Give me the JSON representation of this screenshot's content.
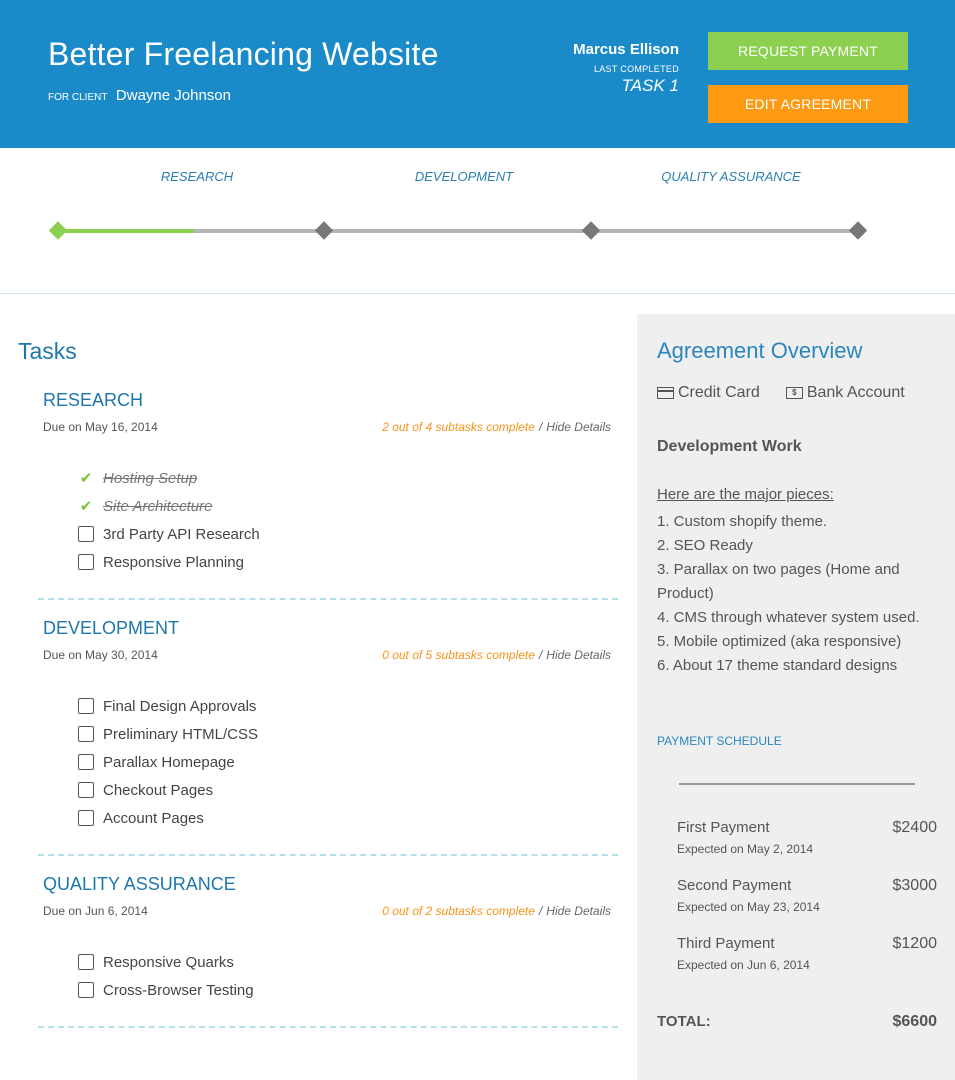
{
  "header": {
    "project_title": "Better Freelancing Website",
    "client_prefix": "For Client",
    "client_name": "Dwayne Johnson",
    "freelancer_name": "Marcus Ellison",
    "last_completed_label": "Last Completed",
    "last_completed_value": "TASK 1",
    "request_payment_label": "Request Payment",
    "edit_agreement_label": "Edit Agreement",
    "colors": {
      "header_bg": "#1a8ac9",
      "request_btn": "#8bd04f",
      "edit_btn": "#fd9a11"
    }
  },
  "progress": {
    "phases": [
      "Research",
      "Development",
      "Quality Assurance"
    ],
    "milestones_completed": 1,
    "fill_fraction": 0.17,
    "colors": {
      "done": "#8bd04f",
      "pending": "#777777"
    }
  },
  "tasks": {
    "title": "Tasks",
    "groups": [
      {
        "title": "Research",
        "due": "Due on May 16, 2014",
        "summary": "2 out of 4 subtasks complete",
        "hide_label": "Hide Details",
        "subtasks": [
          {
            "label": "Hosting Setup",
            "complete": true
          },
          {
            "label": "Site Architecture",
            "complete": true
          },
          {
            "label": "3rd Party API Research",
            "complete": false
          },
          {
            "label": "Responsive Planning",
            "complete": false
          }
        ]
      },
      {
        "title": "Development",
        "due": "Due on May 30, 2014",
        "summary": "0 out of 5 subtasks complete",
        "hide_label": "Hide Details",
        "subtasks": [
          {
            "label": "Final Design Approvals",
            "complete": false
          },
          {
            "label": "Preliminary HTML/CSS",
            "complete": false
          },
          {
            "label": "Parallax Homepage",
            "complete": false
          },
          {
            "label": "Checkout Pages",
            "complete": false
          },
          {
            "label": "Account Pages",
            "complete": false
          }
        ]
      },
      {
        "title": "Quality Assurance",
        "due": "Due on Jun 6, 2014",
        "summary": "0 out of 2 subtasks complete",
        "hide_label": "Hide Details",
        "subtasks": [
          {
            "label": "Responsive Quarks",
            "complete": false
          },
          {
            "label": "Cross-Browser Testing",
            "complete": false
          }
        ]
      }
    ]
  },
  "sidebar": {
    "title": "Agreement Overview",
    "payment_methods": [
      {
        "label": "Credit Card",
        "icon": "credit-card-icon"
      },
      {
        "label": "Bank Account",
        "icon": "bank-account-icon"
      }
    ],
    "agreement_title": "Development Work",
    "agreement_intro": "Here are the major pieces:",
    "agreement_items": [
      "1. Custom shopify theme.",
      "2. SEO Ready",
      "3. Parallax on two pages (Home and Product)",
      "4. CMS through whatever system used.",
      "5. Mobile optimized (aka responsive)",
      "6. About 17 theme standard designs"
    ],
    "schedule_label": "Payment Schedule",
    "payments": [
      {
        "name": "First Payment",
        "amount": "$2400",
        "date": "Expected on May 2, 2014"
      },
      {
        "name": "Second Payment",
        "amount": "$3000",
        "date": "Expected on May 23, 2014"
      },
      {
        "name": "Third Payment",
        "amount": "$1200",
        "date": "Expected on Jun 6, 2014"
      }
    ],
    "total_label": "TOTAL:",
    "total_amount": "$6600"
  }
}
